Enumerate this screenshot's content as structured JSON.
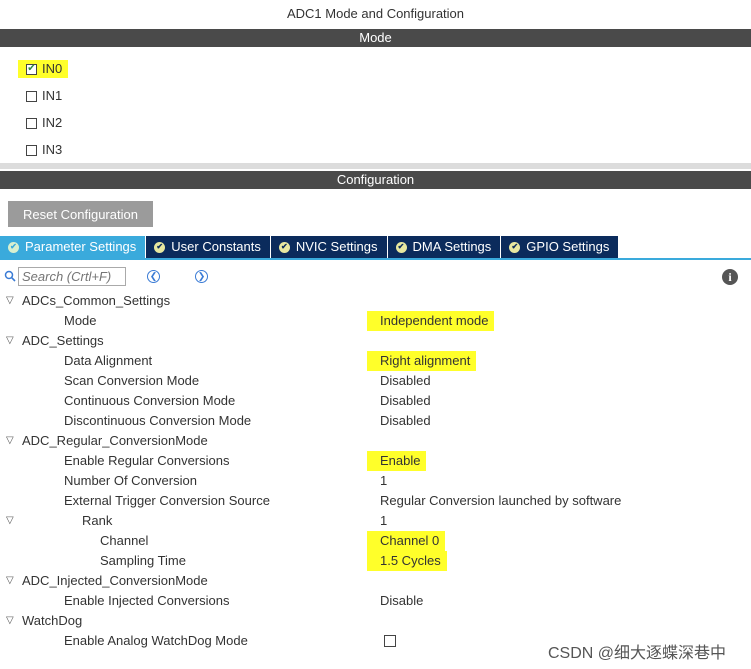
{
  "window": {
    "title": "ADC1 Mode and Configuration"
  },
  "mode": {
    "header": "Mode",
    "inputs": [
      {
        "label": "IN0",
        "checked": true
      },
      {
        "label": "IN1",
        "checked": false
      },
      {
        "label": "IN2",
        "checked": false
      },
      {
        "label": "IN3",
        "checked": false
      }
    ]
  },
  "configuration": {
    "header": "Configuration",
    "reset_label": "Reset Configuration",
    "tabs": [
      {
        "label": "Parameter Settings",
        "active": true
      },
      {
        "label": "User Constants",
        "active": false
      },
      {
        "label": "NVIC Settings",
        "active": false
      },
      {
        "label": "DMA Settings",
        "active": false
      },
      {
        "label": "GPIO Settings",
        "active": false
      }
    ],
    "search": {
      "placeholder": "Search (Crtl+F)"
    }
  },
  "tree": [
    {
      "label": "ADCs_Common_Settings",
      "level": 0,
      "caret": true
    },
    {
      "label": "Mode",
      "level": 1,
      "value": "Independent mode",
      "highlight": true
    },
    {
      "label": "ADC_Settings",
      "level": 0,
      "caret": true
    },
    {
      "label": "Data Alignment",
      "level": 1,
      "value": "Right alignment",
      "highlight": true
    },
    {
      "label": "Scan Conversion Mode",
      "level": 1,
      "value": "Disabled"
    },
    {
      "label": "Continuous Conversion Mode",
      "level": 1,
      "value": "Disabled"
    },
    {
      "label": "Discontinuous Conversion Mode",
      "level": 1,
      "value": "Disabled"
    },
    {
      "label": "ADC_Regular_ConversionMode",
      "level": 0,
      "caret": true
    },
    {
      "label": "Enable Regular Conversions",
      "level": 1,
      "value": "Enable",
      "highlight": true
    },
    {
      "label": "Number Of Conversion",
      "level": 1,
      "value": "1"
    },
    {
      "label": "External Trigger Conversion Source",
      "level": 1,
      "value": "Regular Conversion launched by software"
    },
    {
      "label": "Rank",
      "level": 2,
      "value": "1",
      "caret": true
    },
    {
      "label": "Channel",
      "level": 3,
      "value": "Channel 0",
      "highlight": true
    },
    {
      "label": "Sampling Time",
      "level": 3,
      "value": "1.5 Cycles",
      "highlight": true
    },
    {
      "label": "ADC_Injected_ConversionMode",
      "level": 0,
      "caret": true
    },
    {
      "label": "Enable Injected Conversions",
      "level": 1,
      "value": "Disable"
    },
    {
      "label": "WatchDog",
      "level": 0,
      "caret": true
    },
    {
      "label": "Enable Analog WatchDog Mode",
      "level": 1,
      "checkbox": true,
      "checked": false
    }
  ],
  "watermark": "CSDN @细大逐蝶深巷中",
  "colors": {
    "tab_active": "#3aaadc",
    "tab_inactive": "#0b2b5c",
    "highlight": "#ffff2a",
    "section_bar": "#4a4a4a"
  }
}
